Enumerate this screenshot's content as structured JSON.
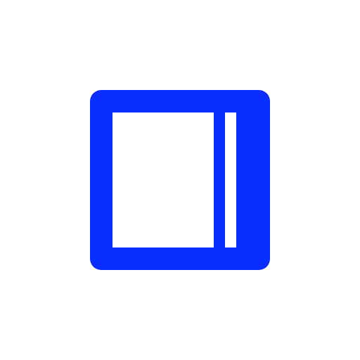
{
  "icon": {
    "name": "sidebar-right-panel-icon",
    "accent_color": "#0a2dff",
    "background_color": "#ffffff",
    "inner_color": "#ffffff"
  }
}
